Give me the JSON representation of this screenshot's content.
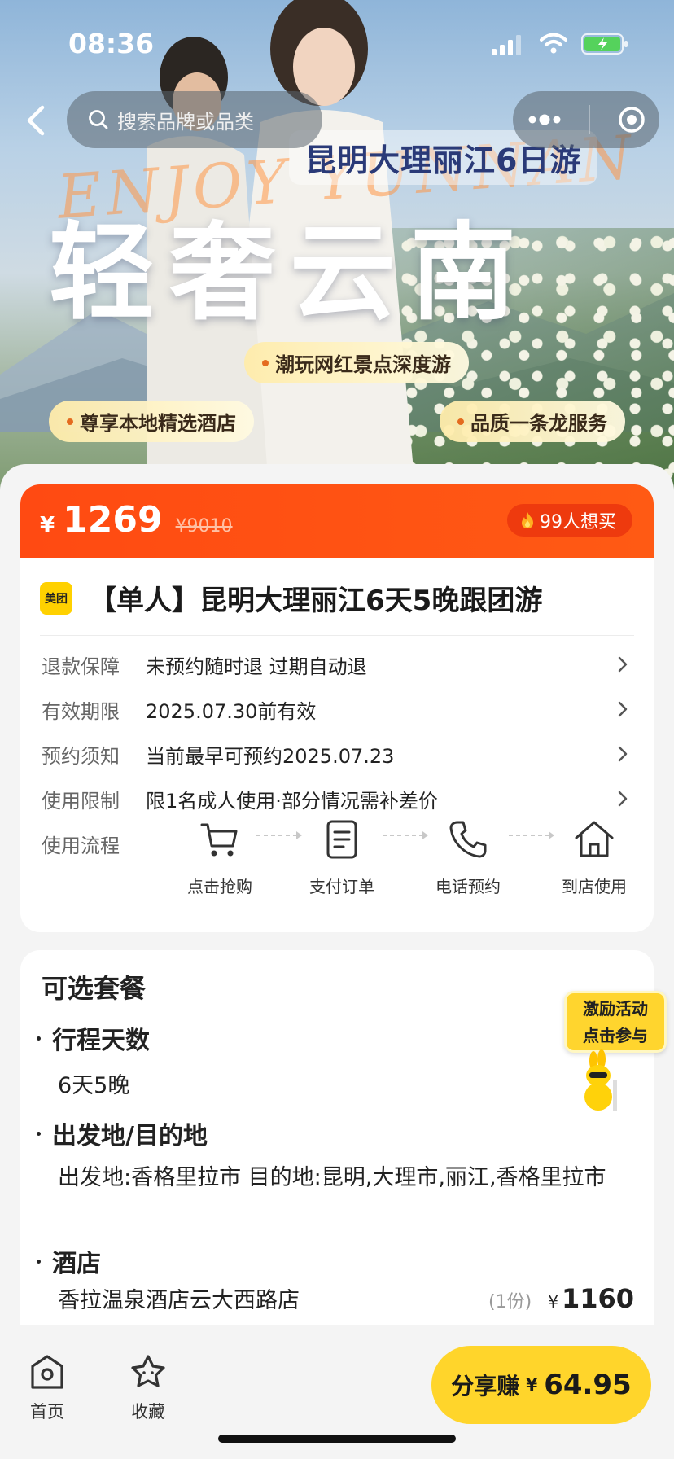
{
  "status": {
    "time": "08:36"
  },
  "nav": {
    "search_placeholder": "搜索品牌或品类"
  },
  "banner": {
    "script_text": "ENJOY YUNNAN",
    "subtitle": "昆明大理丽江6日游",
    "title": "轻奢云南",
    "features": [
      "潮玩网红景点深度游",
      "尊享本地精选酒店",
      "品质一条龙服务"
    ]
  },
  "product": {
    "currency": "¥",
    "price": "1269",
    "original_price": "¥9010",
    "want_count": "99人想买",
    "brand_logo": "美团",
    "title": "【单人】昆明大理丽江6天5晚跟团游",
    "info": [
      {
        "key": "退款保障",
        "value": "未预约随时退 过期自动退"
      },
      {
        "key": "有效期限",
        "value": "2025.07.30前有效"
      },
      {
        "key": "预约须知",
        "value": "当前最早可预约2025.07.23"
      },
      {
        "key": "使用限制",
        "value": "限1名成人使用·部分情况需补差价"
      }
    ],
    "flow_label": "使用流程",
    "flow_steps": [
      "点击抢购",
      "支付订单",
      "电话预约",
      "到店使用"
    ]
  },
  "packages": {
    "title": "可选套餐",
    "days_label": "行程天数",
    "days_value": "6天5晚",
    "route_label": "出发地/目的地",
    "route_value": "出发地:香格里拉市 目的地:昆明,大理市,丽江,香格里拉市",
    "hotel_label": "酒店",
    "hotel_name": "香拉温泉酒店云大西路店",
    "hotel_qty": "(1份)",
    "hotel_currency": "¥",
    "hotel_price": "1160"
  },
  "promo": {
    "line1": "激励活动",
    "line2": "点击参与"
  },
  "bottom": {
    "tab_home": "首页",
    "tab_fav": "收藏",
    "share_label": "分享赚",
    "share_currency": "¥",
    "share_amount": "64.95"
  },
  "colors": {
    "accent_orange": "#ff4a12",
    "share_yellow": "#ffd52b",
    "brand_yellow": "#ffd100"
  }
}
